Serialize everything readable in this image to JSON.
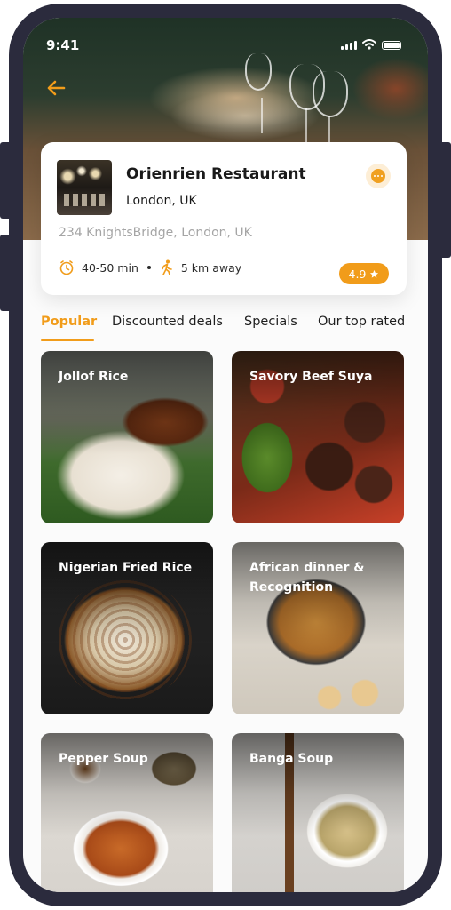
{
  "status_bar": {
    "time": "9:41"
  },
  "restaurant": {
    "name": "Orienrien Restaurant",
    "city": "London, UK",
    "address": "234 KnightsBridge, London, UK",
    "delivery_time": "40-50 min",
    "distance": "5 km away",
    "rating": "4.9"
  },
  "tabs": [
    {
      "label": "Popular",
      "active": true
    },
    {
      "label": "Discounted deals",
      "active": false
    },
    {
      "label": "Specials",
      "active": false
    },
    {
      "label": "Our top rated",
      "active": false
    }
  ],
  "dishes": [
    {
      "name": "Jollof Rice"
    },
    {
      "name": "Savory Beef Suya"
    },
    {
      "name": "Nigerian Fried Rice"
    },
    {
      "name": "African dinner & Recognition"
    },
    {
      "name": "Pepper Soup"
    },
    {
      "name": "Banga Soup"
    }
  ],
  "icons": {
    "back": "arrow-left-icon",
    "chat": "chat-icon",
    "clock": "clock-icon",
    "walk": "walking-icon",
    "star": "star-icon"
  },
  "colors": {
    "accent": "#f19c1a",
    "frame": "#2b2b3d",
    "muted_text": "#a5a5a5"
  }
}
